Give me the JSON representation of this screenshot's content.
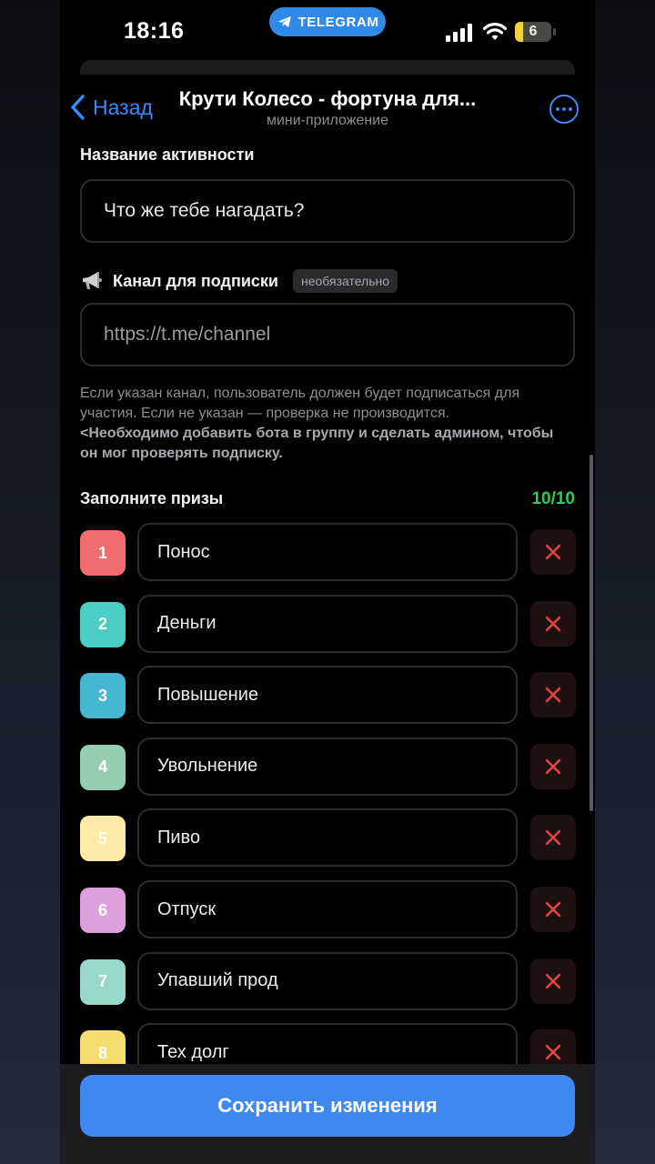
{
  "status_bar": {
    "time": "18:16",
    "app_pill": "TELEGRAM",
    "battery": "6",
    "battery_level": 0.06
  },
  "header": {
    "back_label": "Назад",
    "title": "Крути Колесо - фортуна для...",
    "subtitle": "мини-приложение",
    "accent_color": "#3e88f7"
  },
  "form": {
    "activity_label": "Название активности",
    "activity_value": "Что же тебе нагадать?",
    "channel_label": "Канал для подписки",
    "channel_optional": "необязательно",
    "channel_placeholder": "https://t.me/channel",
    "hint_line1": "Если указан канал, пользователь должен будет подписаться для участия. Если не указан — проверка не производится.",
    "hint_bold": "<Необходимо добавить бота в группу и сделать админом, чтобы он мог проверять подписку."
  },
  "prizes": {
    "label": "Заполните призы",
    "count": "10/10",
    "count_color": "#34c759",
    "items": [
      {
        "num": "1",
        "name": "Понос",
        "color": "#f26d6d"
      },
      {
        "num": "2",
        "name": "Деньги",
        "color": "#4ecdc4"
      },
      {
        "num": "3",
        "name": "Повышение",
        "color": "#45b7d1"
      },
      {
        "num": "4",
        "name": "Увольнение",
        "color": "#96ceb4"
      },
      {
        "num": "5",
        "name": "Пиво",
        "color": "#ffeaa7"
      },
      {
        "num": "6",
        "name": "Отпуск",
        "color": "#dda0dd"
      },
      {
        "num": "7",
        "name": "Упавший прод",
        "color": "#98d8c8"
      },
      {
        "num": "8",
        "name": "Тех долг",
        "color": "#f7dc6f"
      }
    ]
  },
  "footer": {
    "save_label": "Сохранить изменения",
    "save_color": "#3e88f0"
  }
}
